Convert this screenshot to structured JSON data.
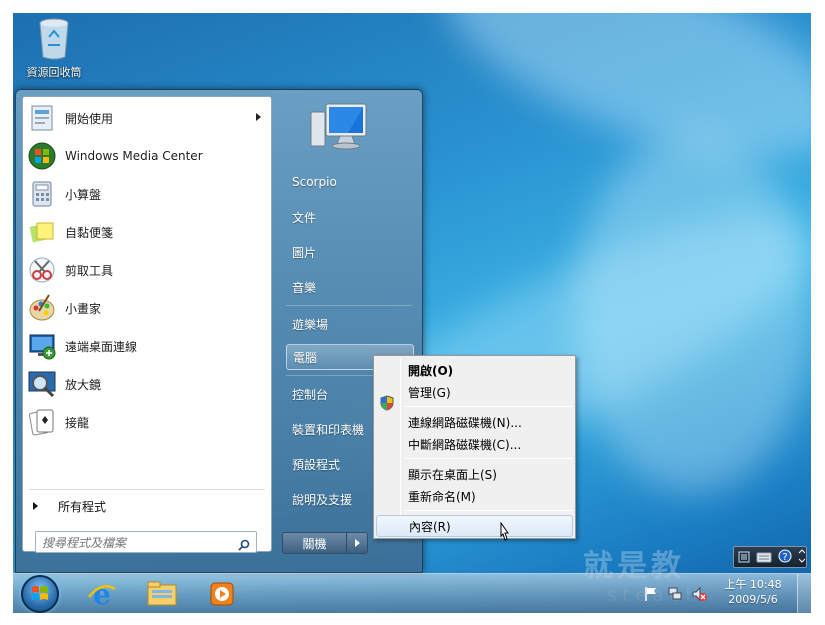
{
  "desktop": {
    "recycle_bin_label": "資源回收筒"
  },
  "start_menu": {
    "programs": [
      {
        "label": "開始使用",
        "icon": "getting-started-icon",
        "has_submenu": true
      },
      {
        "label": "Windows Media Center",
        "icon": "media-center-icon",
        "has_submenu": false
      },
      {
        "label": "小算盤",
        "icon": "calculator-icon",
        "has_submenu": false
      },
      {
        "label": "自黏便箋",
        "icon": "sticky-notes-icon",
        "has_submenu": false
      },
      {
        "label": "剪取工具",
        "icon": "snipping-tool-icon",
        "has_submenu": false
      },
      {
        "label": "小畫家",
        "icon": "paint-icon",
        "has_submenu": false
      },
      {
        "label": "遠端桌面連線",
        "icon": "remote-desktop-icon",
        "has_submenu": false
      },
      {
        "label": "放大鏡",
        "icon": "magnifier-icon",
        "has_submenu": false
      },
      {
        "label": "接龍",
        "icon": "solitaire-icon",
        "has_submenu": false
      }
    ],
    "all_programs": "所有程式",
    "search_placeholder": "搜尋程式及檔案",
    "right_links": {
      "user": "Scorpio",
      "documents": "文件",
      "pictures": "圖片",
      "music": "音樂",
      "games": "遊樂場",
      "computer": "電腦",
      "control_panel": "控制台",
      "devices": "裝置和印表機",
      "default_programs": "預設程式",
      "help": "說明及支援"
    },
    "shutdown_label": "關機"
  },
  "context_menu": {
    "open": "開啟(O)",
    "manage": "管理(G)",
    "map_drive": "連線網路磁碟機(N)...",
    "disconnect_drive": "中斷網路磁碟機(C)...",
    "show_on_desktop": "顯示在桌面上(S)",
    "rename": "重新命名(M)",
    "properties": "內容(R)"
  },
  "taskbar": {
    "pinned": [
      "internet-explorer-icon",
      "windows-explorer-icon",
      "media-player-icon"
    ],
    "time": "上午 10:48",
    "date": "2009/5/6"
  },
  "watermark": {
    "text1": "就是教",
    "text2": "steach"
  },
  "colors": {
    "accent": "#2a93d2",
    "menu_highlight": "#dce9f8"
  }
}
